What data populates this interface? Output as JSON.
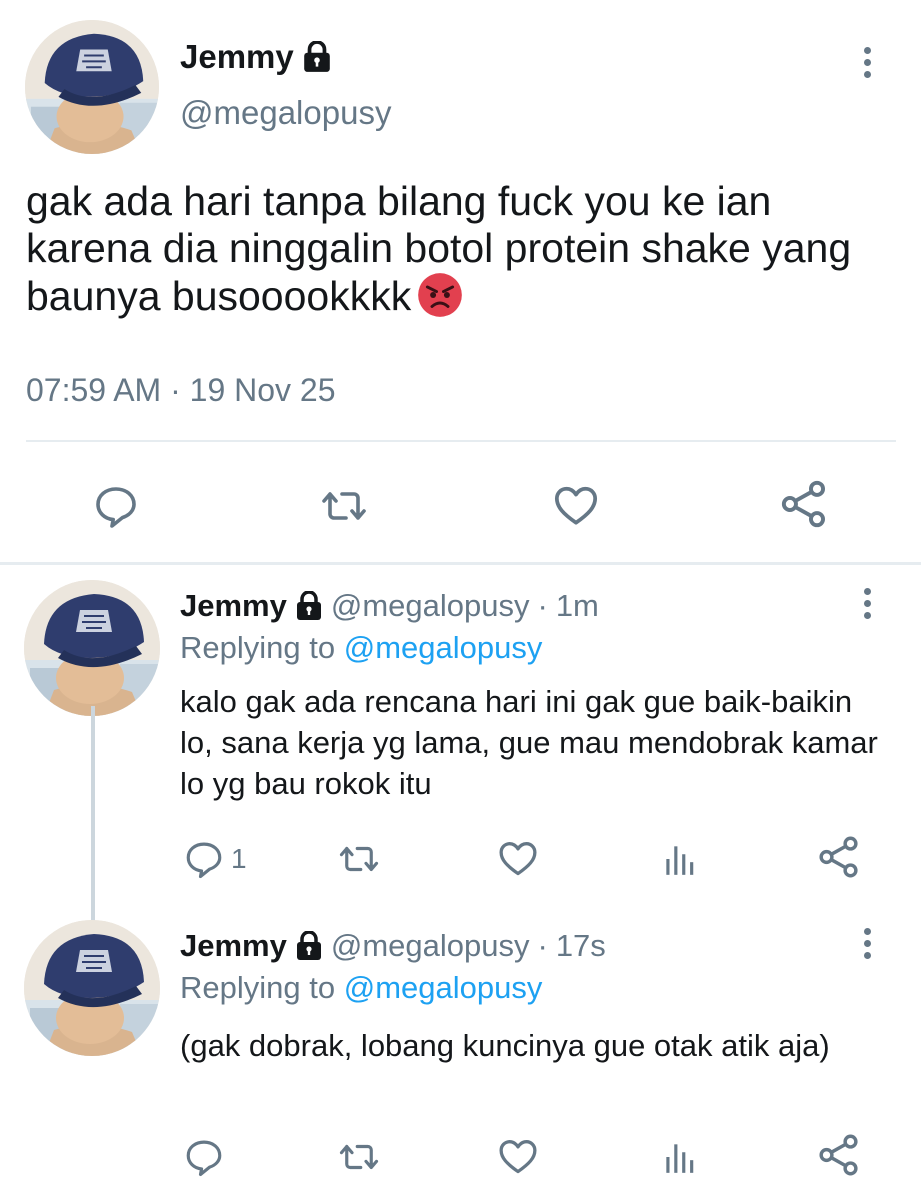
{
  "main_tweet": {
    "name": "Jemmy",
    "handle": "@megalopusy",
    "text": "gak ada hari tanpa bilang fuck you ke ian karena dia ninggalin botol protein shake yang baunya busooookkkk",
    "emoji": "angry-face",
    "timestamp": "07:59 AM · 19 Nov 25",
    "actions": [
      "reply-icon",
      "retweet-icon",
      "like-icon",
      "share-icon"
    ]
  },
  "replies": [
    {
      "name": "Jemmy",
      "handle": "@megalopusy",
      "separator": "·",
      "time": "1m",
      "replying_prefix": "Replying to",
      "replying_to": "@megalopusy",
      "text": "kalo gak ada rencana hari ini gak gue baik-baikin lo, sana kerja yg lama, gue mau mendobrak kamar lo yg bau rokok itu",
      "reply_count": "1"
    },
    {
      "name": "Jemmy",
      "handle": "@megalopusy",
      "separator": "·",
      "time": "17s",
      "replying_prefix": "Replying to",
      "replying_to": "@megalopusy",
      "text": "(gak dobrak, lobang kuncinya gue otak atik aja)",
      "reply_count": ""
    }
  ],
  "colors": {
    "text": "#14171a",
    "secondary": "#657786",
    "link": "#1da1f2",
    "divider": "#e6ecf0"
  }
}
